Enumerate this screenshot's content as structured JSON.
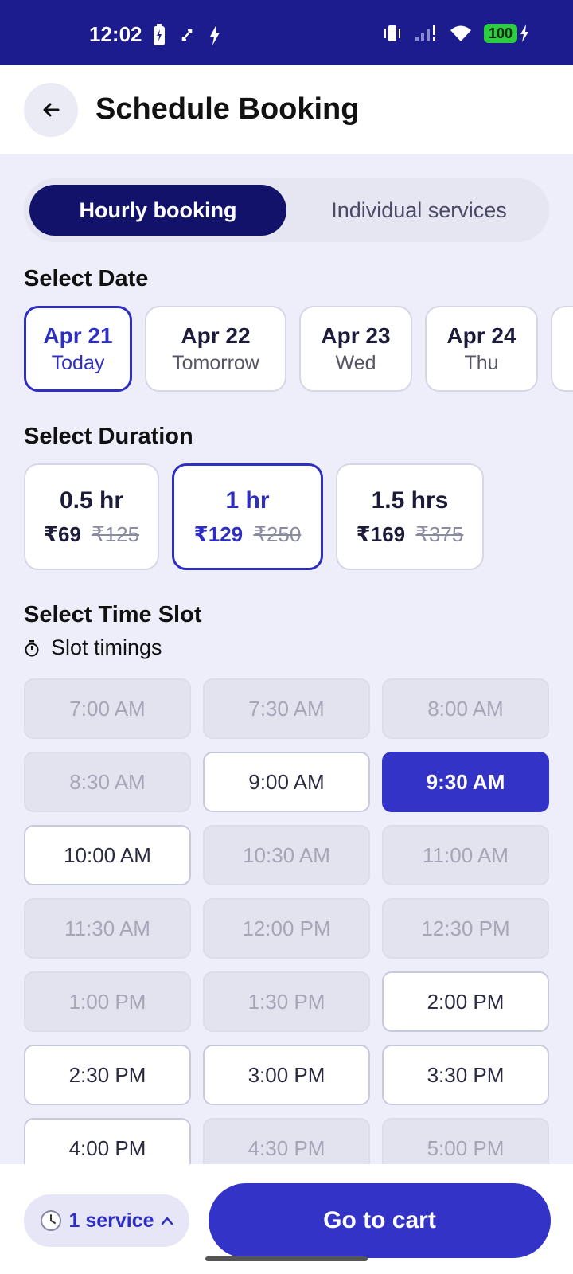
{
  "status_bar": {
    "time": "12:02",
    "battery": "100"
  },
  "header": {
    "title": "Schedule Booking"
  },
  "tabs": [
    {
      "label": "Hourly booking",
      "active": true
    },
    {
      "label": "Individual services",
      "active": false
    }
  ],
  "date_section": {
    "title": "Select Date",
    "dates": [
      {
        "date": "Apr 21",
        "day": "Today",
        "selected": true
      },
      {
        "date": "Apr 22",
        "day": "Tomorrow",
        "selected": false
      },
      {
        "date": "Apr 23",
        "day": "Wed",
        "selected": false
      },
      {
        "date": "Apr 24",
        "day": "Thu",
        "selected": false
      }
    ]
  },
  "duration_section": {
    "title": "Select Duration",
    "options": [
      {
        "label": "0.5 hr",
        "price": "₹69",
        "mrp": "₹125",
        "selected": false
      },
      {
        "label": "1 hr",
        "price": "₹129",
        "mrp": "₹250",
        "selected": true
      },
      {
        "label": "1.5 hrs",
        "price": "₹169",
        "mrp": "₹375",
        "selected": false
      }
    ]
  },
  "time_section": {
    "title": "Select Time Slot",
    "subtitle": "Slot timings",
    "slots": [
      {
        "time": "7:00 AM",
        "state": "unavailable"
      },
      {
        "time": "7:30 AM",
        "state": "unavailable"
      },
      {
        "time": "8:00 AM",
        "state": "unavailable"
      },
      {
        "time": "8:30 AM",
        "state": "unavailable"
      },
      {
        "time": "9:00 AM",
        "state": "available"
      },
      {
        "time": "9:30 AM",
        "state": "selected"
      },
      {
        "time": "10:00 AM",
        "state": "available"
      },
      {
        "time": "10:30 AM",
        "state": "unavailable"
      },
      {
        "time": "11:00 AM",
        "state": "unavailable"
      },
      {
        "time": "11:30 AM",
        "state": "unavailable"
      },
      {
        "time": "12:00 PM",
        "state": "unavailable"
      },
      {
        "time": "12:30 PM",
        "state": "unavailable"
      },
      {
        "time": "1:00 PM",
        "state": "unavailable"
      },
      {
        "time": "1:30 PM",
        "state": "unavailable"
      },
      {
        "time": "2:00 PM",
        "state": "available"
      },
      {
        "time": "2:30 PM",
        "state": "available"
      },
      {
        "time": "3:00 PM",
        "state": "available"
      },
      {
        "time": "3:30 PM",
        "state": "available"
      },
      {
        "time": "4:00 PM",
        "state": "available"
      },
      {
        "time": "4:30 PM",
        "state": "unavailable"
      },
      {
        "time": "5:00 PM",
        "state": "unavailable"
      }
    ]
  },
  "footer": {
    "service_count": "1 service",
    "cart_label": "Go to cart"
  },
  "colors": {
    "primary": "#3333c8",
    "navy": "#12126b",
    "status_bar": "#1c1c8f",
    "background": "#eeeefa"
  },
  "icons": [
    "back-arrow-icon",
    "stopwatch-icon",
    "clock-icon",
    "chevron-up-icon"
  ]
}
